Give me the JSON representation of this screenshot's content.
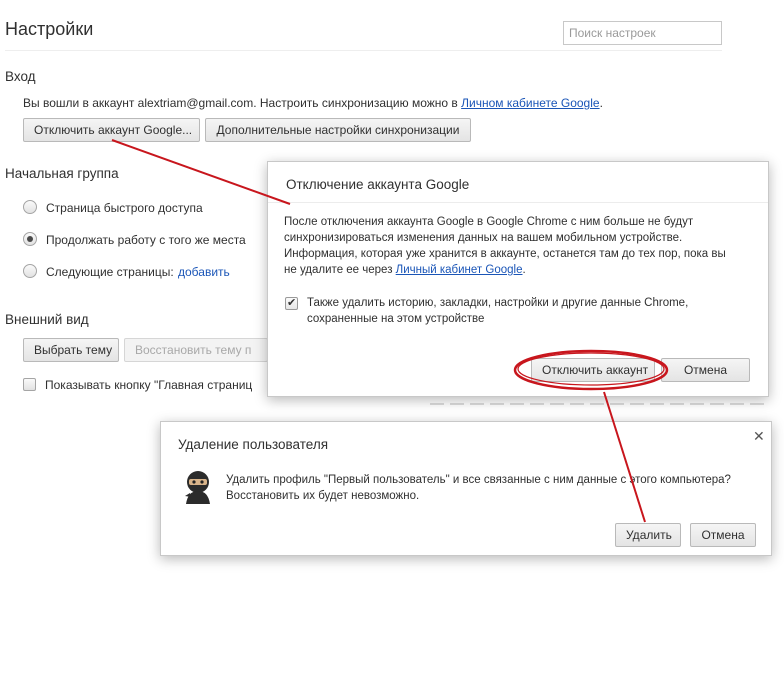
{
  "settings": {
    "title": "Настройки",
    "search_placeholder": "Поиск настроек",
    "signin": {
      "heading": "Вход",
      "text_before": "Вы вошли в аккаунт alextriam@gmail.com. Настроить синхронизацию можно в ",
      "link": "Личном кабинете Google",
      "text_after": ".",
      "disconnect_button": "Отключить аккаунт Google...",
      "advanced_sync_button": "Дополнительные настройки синхронизации"
    },
    "startup": {
      "heading": "Начальная группа",
      "options": [
        {
          "label": "Страница быстрого доступа",
          "checked": false
        },
        {
          "label": "Продолжать работу с того же места",
          "checked": true
        },
        {
          "label": "Следующие страницы:",
          "checked": false
        }
      ],
      "add_link": "добавить"
    },
    "appearance": {
      "heading": "Внешний вид",
      "choose_theme_button": "Выбрать тему",
      "restore_theme_button": "Восстановить тему п",
      "home_button_checkbox": "Показывать кнопку \"Главная страниц"
    }
  },
  "disconnect_dialog": {
    "title": "Отключение аккаунта Google",
    "body_line1": "После отключения аккаунта Google в Google Chrome с ним больше не будут",
    "body_line2": "синхронизироваться изменения данных на вашем мобильном устройстве.",
    "body_line3": "Информация, которая уже хранится в аккаунте, останется там до тех пор, пока вы",
    "body_line4_before": "не удалите ее через ",
    "body_line4_link": "Личный кабинет Google",
    "body_line4_after": ".",
    "checkbox_line1": "Также удалить историю, закладки, настройки и другие данные Chrome,",
    "checkbox_line2": "сохраненные на этом устройстве",
    "checkbox_checked": true,
    "confirm_button": "Отключить аккаунт",
    "cancel_button": "Отмена"
  },
  "delete_user_dialog": {
    "title": "Удаление пользователя",
    "body_line1": "Удалить профиль \"Первый пользователь\" и все связанные с ним данные с этого компьютера?",
    "body_line2": "Восстановить их будет невозможно.",
    "delete_button": "Удалить",
    "cancel_button": "Отмена",
    "avatar_icon": "ninja-avatar-icon"
  },
  "colors": {
    "annotation_red": "#c8161d",
    "link_blue": "#1a55b7"
  }
}
